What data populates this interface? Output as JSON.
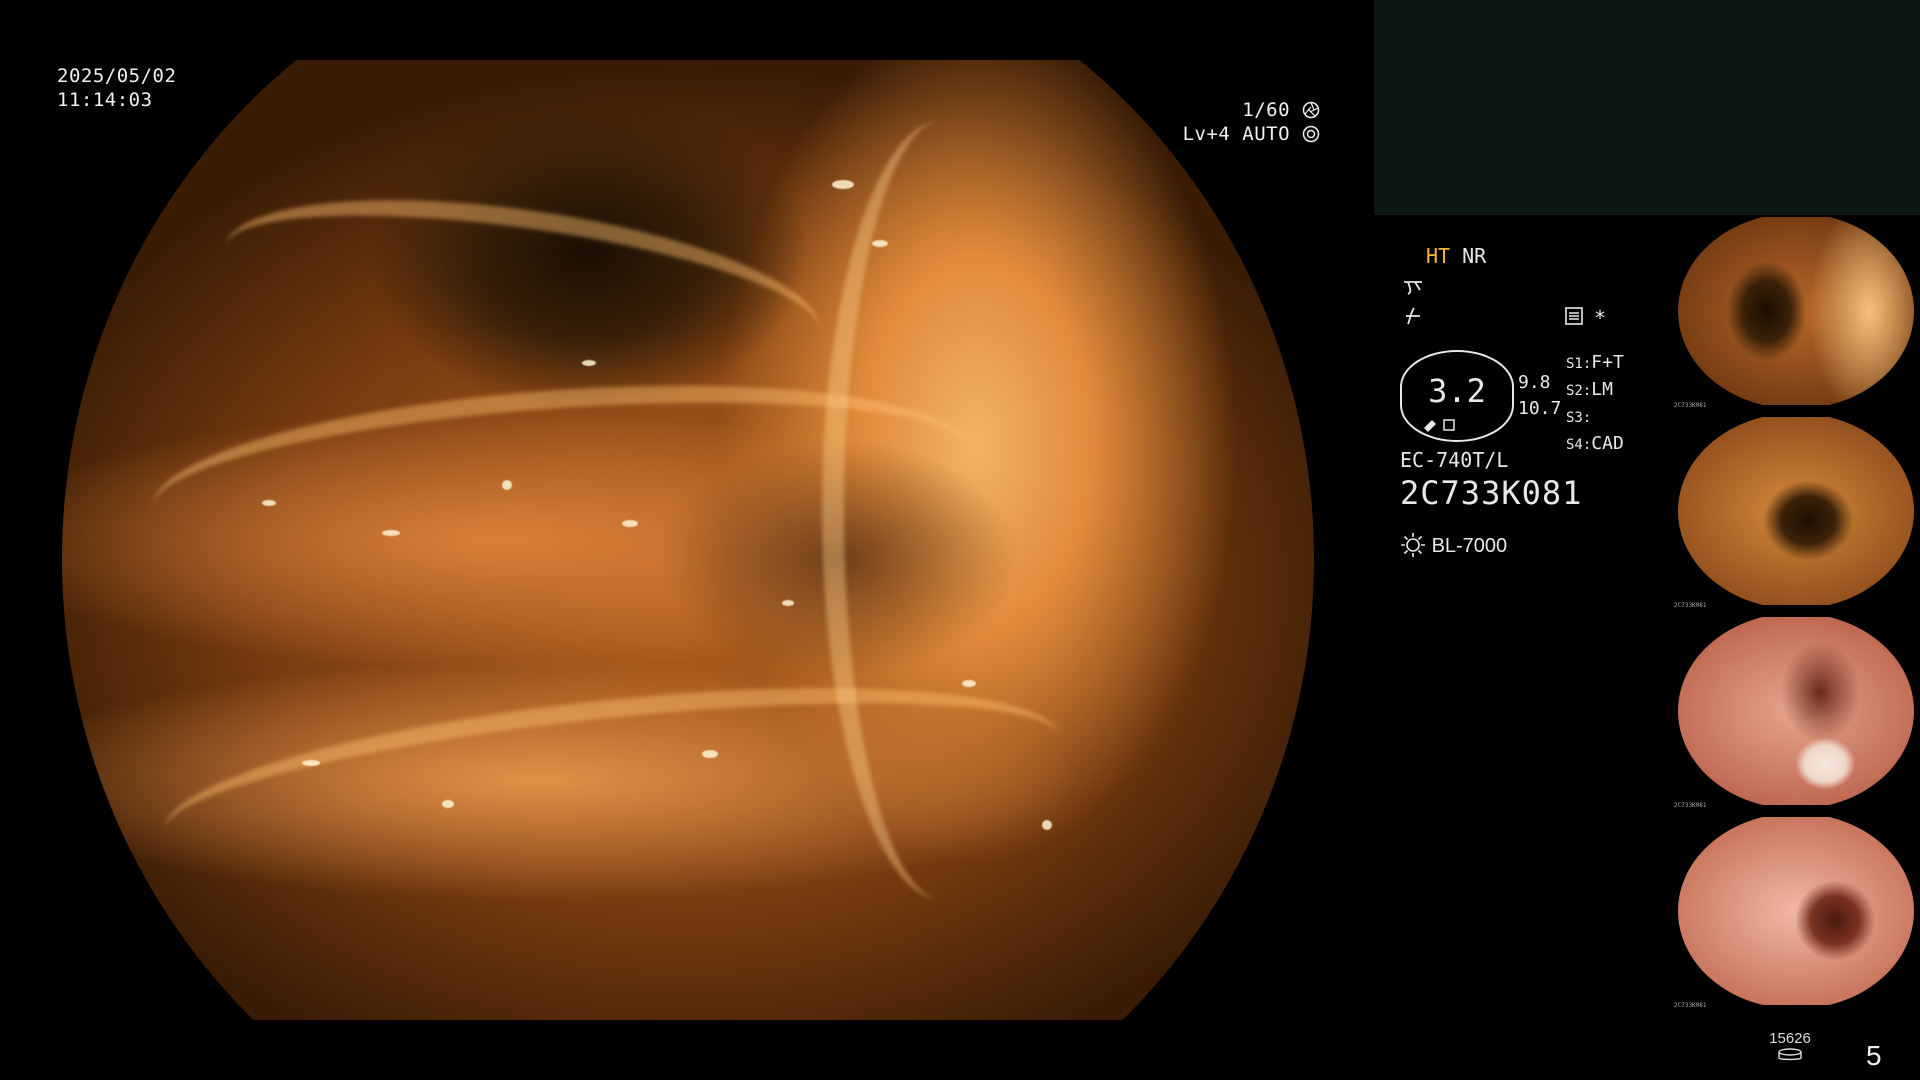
{
  "header": {
    "date": "2025/05/02",
    "time": "11:14:03"
  },
  "exposure": {
    "shutter": "1/60",
    "level": "Lv+4 AUTO"
  },
  "modes": {
    "ht": "HT",
    "nr": "NR"
  },
  "zoom": {
    "value": "3.2",
    "value_a": "9.8",
    "value_b": "10.7"
  },
  "scope": {
    "model": "EC-740T/L",
    "serial": "2C733K081",
    "light_source": "BL-7000"
  },
  "settings": {
    "asterisk": "*",
    "s1_key": "S1:",
    "s1_value": "F+T",
    "s2_key": "S2:",
    "s2_value": "LM",
    "s3_key": "S3:",
    "s3_value": "",
    "s4_key": "S4:",
    "s4_value": "CAD"
  },
  "thumbnails": [
    {
      "caption": "2C733K081"
    },
    {
      "caption": "2C733K081"
    },
    {
      "caption": "2C733K081"
    },
    {
      "caption": "2C733K081"
    }
  ],
  "footer": {
    "counter": "15626",
    "page": "5"
  },
  "colors": {
    "ht_accent": "#f5b82e",
    "panel_bg": "#0c1815",
    "tissue_light": "#f2b366",
    "tissue_dark": "#7a3d10"
  },
  "icons": {
    "shutter": "aperture-icon",
    "auto": "auto-iris-icon",
    "enhance_a": "structure-enhance-icon",
    "enhance_b": "color-enhance-icon",
    "memory": "memory-icon",
    "lamp": "lamp-icon",
    "storage": "storage-icon"
  }
}
